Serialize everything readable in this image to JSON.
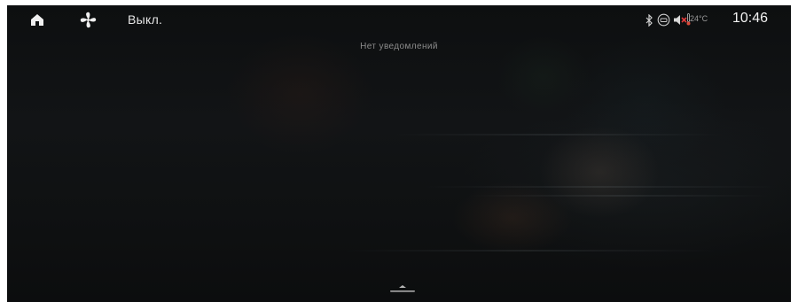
{
  "status_bar": {
    "fan_status": "Выкл.",
    "temperature": "24°C",
    "clock": "10:46",
    "icons": [
      "home-icon",
      "fan-icon",
      "bluetooth-icon",
      "car-signal-icon",
      "volume-muted-icon",
      "thermometer-icon"
    ]
  },
  "notifications": {
    "empty_text": "Нет уведомлений"
  },
  "colors": {
    "background": "#101213",
    "text_primary": "#e6e6e6",
    "text_secondary": "#8c8c8c",
    "mute_accent": "#e23b3b"
  }
}
